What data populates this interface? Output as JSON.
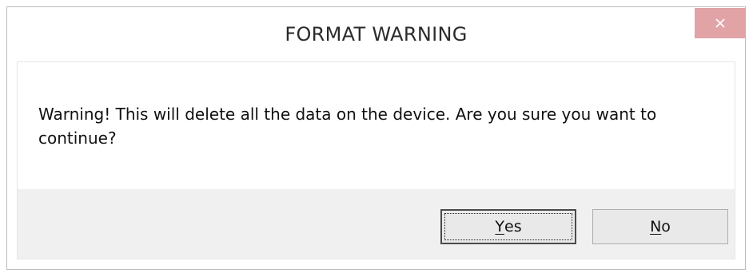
{
  "dialog": {
    "title": "FORMAT WARNING",
    "close_icon": "close-icon",
    "message": "Warning! This will delete all the data on the device. Are you sure you want to continue?",
    "buttons": {
      "yes": {
        "accel": "Y",
        "rest": "es"
      },
      "no": {
        "accel": "N",
        "rest": "o"
      }
    },
    "colors": {
      "close_button_bg": "#e2a3a7",
      "button_bar_bg": "#f0f0f0",
      "button_bg": "#e9e9e9"
    }
  }
}
